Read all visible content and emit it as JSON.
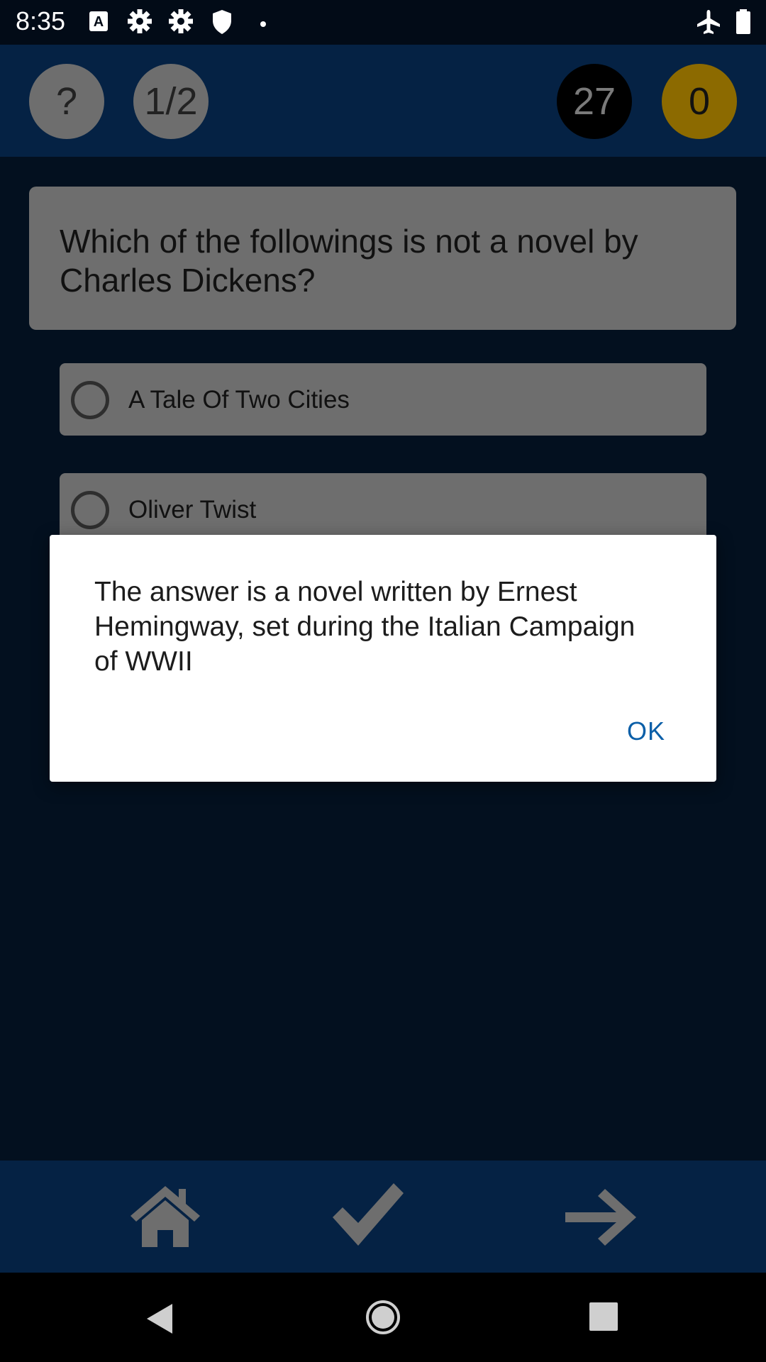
{
  "status_bar": {
    "time": "8:35",
    "icons_left": [
      "keyboard-a-icon",
      "gear-icon",
      "gear-icon",
      "shield-icon",
      "dot-icon"
    ],
    "icons_right": [
      "airplane-icon",
      "battery-icon"
    ]
  },
  "header": {
    "help_label": "?",
    "progress_label": "1/2",
    "timer_value": "27",
    "score_value": "0",
    "colors": {
      "circle_gray": "#6e6e6e",
      "timer_bg": "#000000",
      "score_bg": "#8c6a00"
    }
  },
  "question": {
    "text": "Which of the followings is not a novel by Charles Dickens?"
  },
  "options": [
    {
      "label": "A Tale Of Two Cities"
    },
    {
      "label": "Oliver Twist"
    }
  ],
  "dialog": {
    "message": "The answer is a novel written by Ernest Hemingway, set during the Italian Campaign of WWII",
    "ok_label": "OK"
  },
  "bottom_bar": {
    "icons": [
      "home-icon",
      "checkmark-icon",
      "arrow-right-icon"
    ]
  },
  "nav_bar": {
    "icons": [
      "back-icon",
      "home-circle-icon",
      "recents-icon"
    ]
  },
  "colors": {
    "background": "#03101f",
    "bar": "#052244",
    "card": "#6e6e6e",
    "link": "#0b5fa8"
  }
}
